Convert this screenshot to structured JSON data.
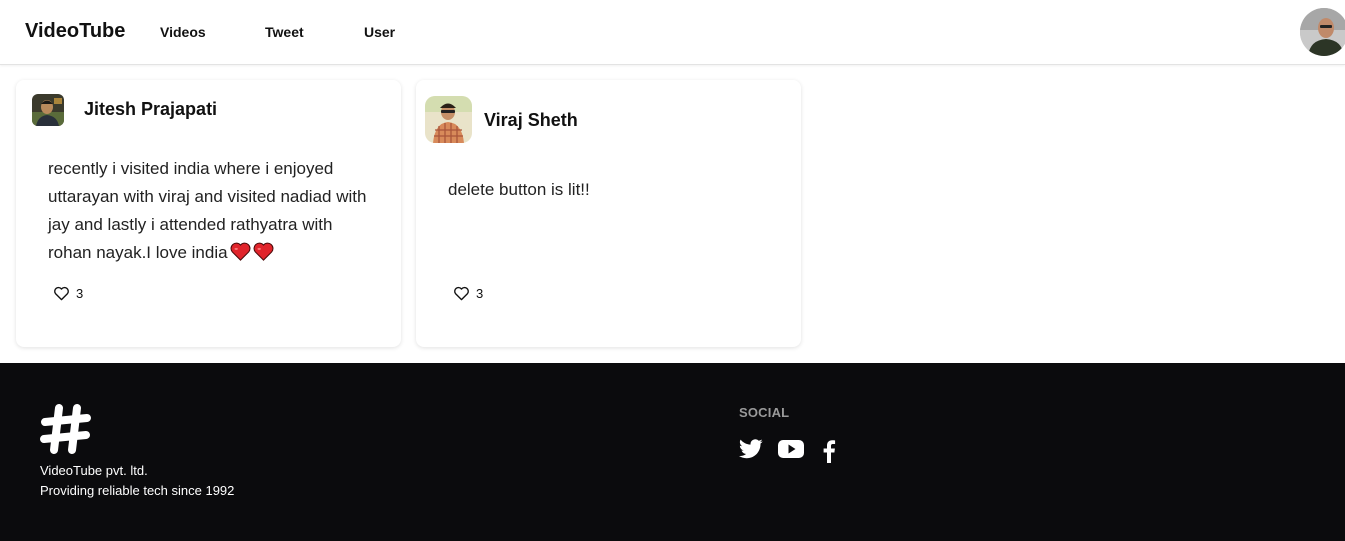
{
  "navbar": {
    "brand": "VideoTube",
    "links": [
      "Videos",
      "Tweet",
      "User"
    ]
  },
  "tweets": [
    {
      "author": "Jitesh Prajapati",
      "text": "recently i visited india where i enjoyed uttarayan with viraj and visited nadiad with jay and lastly i attended rathyatra with rohan nayak.I love india",
      "emoji_count": 2,
      "likes": "3"
    },
    {
      "author": "Viraj Sheth",
      "text": "delete button is lit!!",
      "likes": "3"
    }
  ],
  "footer": {
    "company": "VideoTube pvt. ltd.",
    "tagline": "Providing reliable tech since 1992",
    "social_heading": "SOCIAL",
    "social_icons": [
      "twitter-icon",
      "youtube-icon",
      "facebook-icon"
    ]
  },
  "colors": {
    "footer_bg": "#0b0b0d",
    "heart_emoji": "#e0242b",
    "social_heading": "#9a9a9a"
  }
}
